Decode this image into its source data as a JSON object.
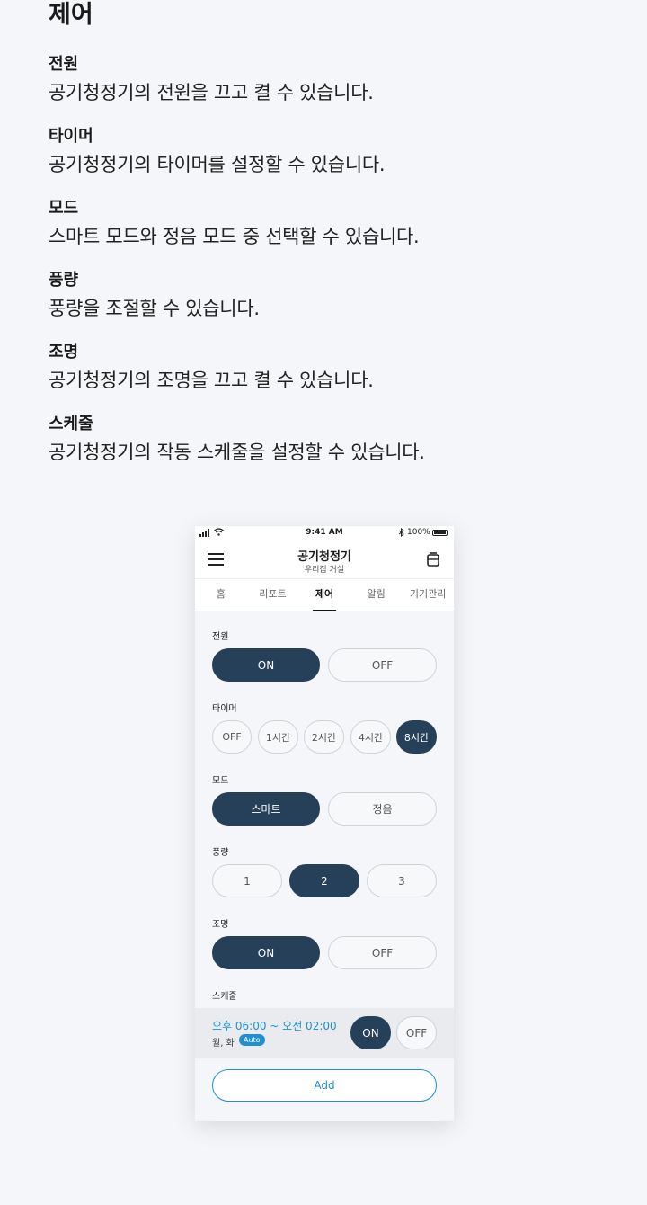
{
  "doc": {
    "title": "제어",
    "sections": [
      {
        "heading": "전원",
        "desc": "공기청정기의 전원을 끄고 켤 수 있습니다."
      },
      {
        "heading": "타이머",
        "desc": "공기청정기의 타이머를 설정할 수 있습니다."
      },
      {
        "heading": "모드",
        "desc": "스마트 모드와 정음 모드 중 선택할 수 있습니다."
      },
      {
        "heading": "풍량",
        "desc": "풍량을 조절할 수 있습니다."
      },
      {
        "heading": "조명",
        "desc": "공기청정기의 조명을 끄고 켤 수 있습니다."
      },
      {
        "heading": "스케줄",
        "desc": "공기청정기의 작동 스케줄을 설정할 수 있습니다."
      }
    ]
  },
  "phone": {
    "status": {
      "time": "9:41 AM",
      "battery": "100%"
    },
    "appbar": {
      "title": "공기청정기",
      "subtitle": "우리집 거실"
    },
    "tabs": [
      "홈",
      "리포트",
      "제어",
      "알림",
      "기기관리"
    ],
    "active_tab": "제어",
    "controls": {
      "power": {
        "label": "전원",
        "on": "ON",
        "off": "OFF",
        "selected": "ON"
      },
      "timer": {
        "label": "타이머",
        "options": [
          "OFF",
          "1시간",
          "2시간",
          "4시간",
          "8시간"
        ],
        "selected": "8시간"
      },
      "mode": {
        "label": "모드",
        "options": [
          "스마트",
          "정음"
        ],
        "selected": "스마트"
      },
      "fan": {
        "label": "풍량",
        "options": [
          "1",
          "2",
          "3"
        ],
        "selected": "2"
      },
      "light": {
        "label": "조명",
        "on": "ON",
        "off": "OFF",
        "selected": "ON"
      },
      "schedule": {
        "label": "스케줄",
        "time": "오후 06:00 ~ 오전 02:00",
        "days": "월, 화",
        "badge": "Auto",
        "on": "ON",
        "off": "OFF",
        "selected": "ON",
        "add": "Add"
      }
    },
    "colors": {
      "accent": "#27405a",
      "link": "#1e8fd0",
      "background": "#f5f6f9"
    }
  }
}
